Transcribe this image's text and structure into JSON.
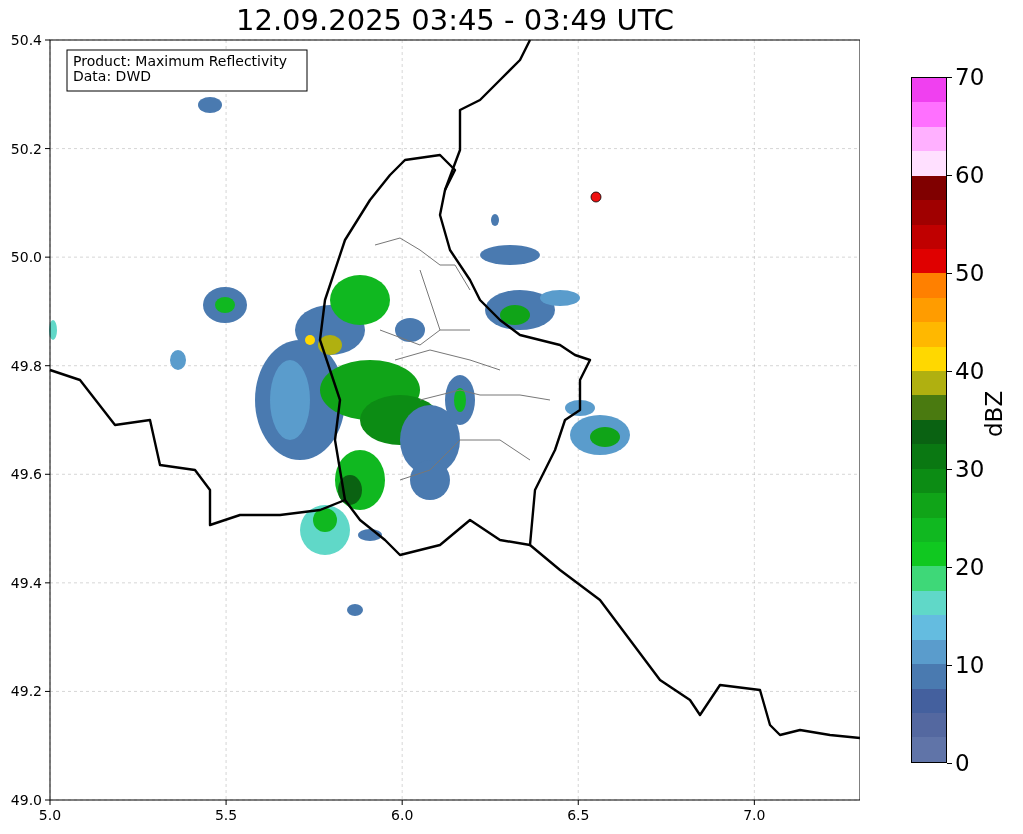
{
  "title": "12.09.2025 03:45 - 03:49 UTC",
  "info_box": [
    "Product: Maximum Reflectivity",
    "Data: DWD"
  ],
  "map": {
    "y_ticks": [
      "50.4",
      "50.2",
      "50.0",
      "49.8",
      "49.6",
      "49.4",
      "49.2",
      "49.0"
    ],
    "x_ticks": [
      "5.0",
      "5.5",
      "6.0",
      "6.5",
      "7.0"
    ]
  },
  "colorbar": {
    "label": "dBZ",
    "ticks": [
      "70",
      "60",
      "50",
      "40",
      "30",
      "20",
      "10",
      "0"
    ],
    "bands": [
      {
        "color": "#6074a8"
      },
      {
        "color": "#5468a0"
      },
      {
        "color": "#44609e"
      },
      {
        "color": "#4a7ab0"
      },
      {
        "color": "#5a9ccc"
      },
      {
        "color": "#64bce0"
      },
      {
        "color": "#60d8c8"
      },
      {
        "color": "#3ed878"
      },
      {
        "color": "#10c820"
      },
      {
        "color": "#10b820"
      },
      {
        "color": "#10a418"
      },
      {
        "color": "#0c8c14"
      },
      {
        "color": "#0a7812"
      },
      {
        "color": "#0a6212"
      },
      {
        "color": "#4a7a10"
      },
      {
        "color": "#b0b010"
      },
      {
        "color": "#ffd800"
      },
      {
        "color": "#ffb800"
      },
      {
        "color": "#ff9c00"
      },
      {
        "color": "#ff8000"
      },
      {
        "color": "#e00000"
      },
      {
        "color": "#c00000"
      },
      {
        "color": "#a00000"
      },
      {
        "color": "#800000"
      },
      {
        "color": "#ffe0ff"
      },
      {
        "color": "#ffb0ff"
      },
      {
        "color": "#ff70ff"
      },
      {
        "color": "#f040f0"
      }
    ]
  }
}
